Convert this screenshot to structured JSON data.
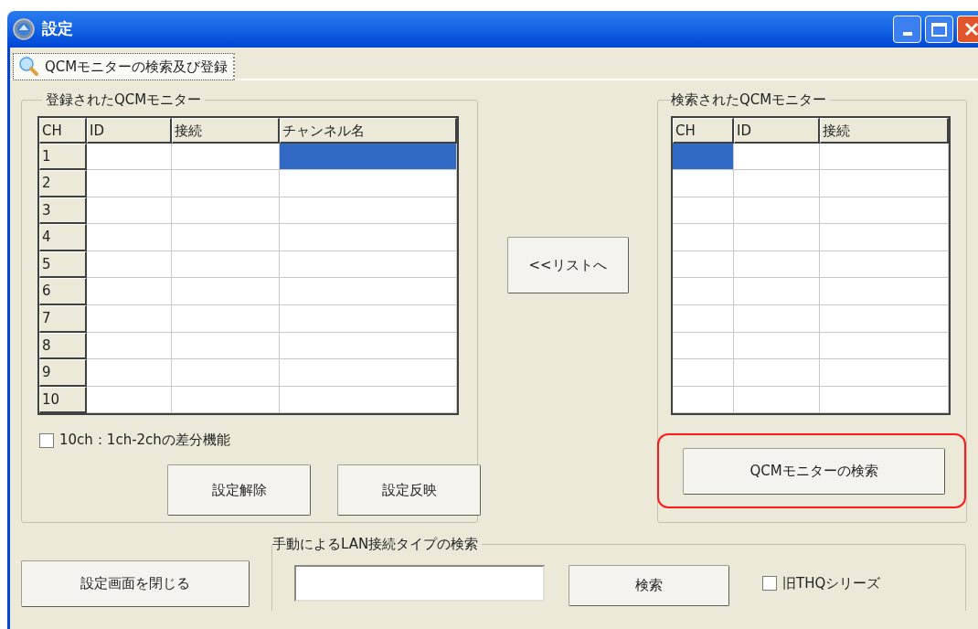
{
  "window": {
    "title": "設定"
  },
  "tabs": [
    {
      "label": "QCMモニターの検索及び登録",
      "selected": true
    }
  ],
  "registered": {
    "title": "登録されたQCMモニター",
    "columns": [
      "CH",
      "ID",
      "接続",
      "チャンネル名"
    ],
    "rows": [
      {
        "ch": "1",
        "cells": [
          {
            "selected": false
          },
          {
            "selected": false
          },
          {
            "selected": true
          }
        ]
      },
      {
        "ch": "2",
        "cells": [
          {
            "selected": false
          },
          {
            "selected": false
          },
          {
            "selected": false
          }
        ]
      },
      {
        "ch": "3",
        "cells": [
          {
            "selected": false
          },
          {
            "selected": false
          },
          {
            "selected": false
          }
        ]
      },
      {
        "ch": "4",
        "cells": [
          {
            "selected": false
          },
          {
            "selected": false
          },
          {
            "selected": false
          }
        ]
      },
      {
        "ch": "5",
        "cells": [
          {
            "selected": false
          },
          {
            "selected": false
          },
          {
            "selected": false
          }
        ]
      },
      {
        "ch": "6",
        "cells": [
          {
            "selected": false
          },
          {
            "selected": false
          },
          {
            "selected": false
          }
        ]
      },
      {
        "ch": "7",
        "cells": [
          {
            "selected": false
          },
          {
            "selected": false
          },
          {
            "selected": false
          }
        ]
      },
      {
        "ch": "8",
        "cells": [
          {
            "selected": false
          },
          {
            "selected": false
          },
          {
            "selected": false
          }
        ]
      },
      {
        "ch": "9",
        "cells": [
          {
            "selected": false
          },
          {
            "selected": false
          },
          {
            "selected": false
          }
        ]
      },
      {
        "ch": "10",
        "cells": [
          {
            "selected": false
          },
          {
            "selected": false
          },
          {
            "selected": false
          }
        ]
      }
    ],
    "checkbox": {
      "label": "10ch：1ch-2chの差分機能",
      "checked": false
    },
    "buttons": [
      "設定解除",
      "設定反映"
    ]
  },
  "move_button": "<<リストへ",
  "found": {
    "title": "検索されたQCMモニター",
    "columns": [
      "CH",
      "ID",
      "接続"
    ],
    "rows": [
      {
        "cells": [
          {
            "selected": true
          },
          {
            "selected": false
          },
          {
            "selected": false
          }
        ]
      },
      {
        "cells": [
          {
            "selected": false
          },
          {
            "selected": false
          },
          {
            "selected": false
          }
        ]
      },
      {
        "cells": [
          {
            "selected": false
          },
          {
            "selected": false
          },
          {
            "selected": false
          }
        ]
      },
      {
        "cells": [
          {
            "selected": false
          },
          {
            "selected": false
          },
          {
            "selected": false
          }
        ]
      },
      {
        "cells": [
          {
            "selected": false
          },
          {
            "selected": false
          },
          {
            "selected": false
          }
        ]
      },
      {
        "cells": [
          {
            "selected": false
          },
          {
            "selected": false
          },
          {
            "selected": false
          }
        ]
      },
      {
        "cells": [
          {
            "selected": false
          },
          {
            "selected": false
          },
          {
            "selected": false
          }
        ]
      },
      {
        "cells": [
          {
            "selected": false
          },
          {
            "selected": false
          },
          {
            "selected": false
          }
        ]
      },
      {
        "cells": [
          {
            "selected": false
          },
          {
            "selected": false
          },
          {
            "selected": false
          }
        ]
      },
      {
        "cells": [
          {
            "selected": false
          },
          {
            "selected": false
          },
          {
            "selected": false
          }
        ]
      }
    ],
    "search_button": {
      "label": "QCMモニターの検索",
      "highlighted": true
    }
  },
  "close_button": "設定画面を閉じる",
  "manual_search": {
    "title": "手動によるLAN接続タイプの検索",
    "button": "検索",
    "checkbox": {
      "label": "旧THQシリーズ",
      "checked": false
    }
  }
}
